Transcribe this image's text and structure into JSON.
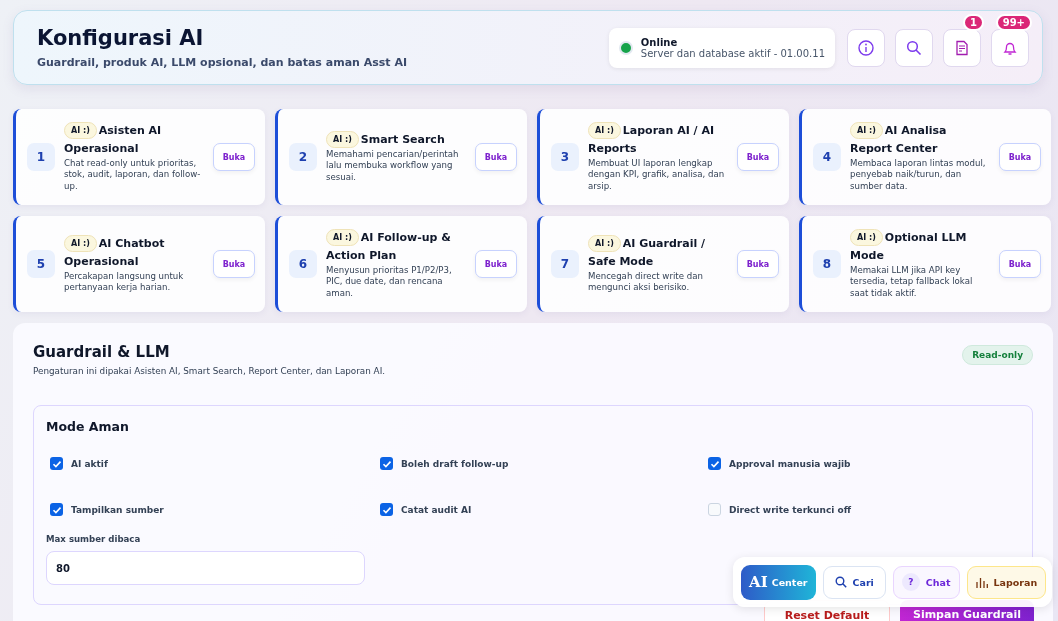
{
  "header": {
    "title": "Konfigurasi AI",
    "subtitle": "Guardrail, produk AI, LLM opsional, dan batas aman Asst AI",
    "status": {
      "online": true,
      "label": "Online",
      "detail": "Server dan database aktif - 01.00.11"
    },
    "actions": [
      {
        "kind": "info"
      },
      {
        "kind": "search"
      },
      {
        "kind": "document",
        "badge": "1"
      },
      {
        "kind": "bell",
        "badge": "99+"
      }
    ]
  },
  "features": [
    {
      "number": "1",
      "tag": "AI :)",
      "title": "Asisten AI Operasional",
      "description": "Chat read-only untuk prioritas, stok, audit, laporan, dan follow-up.",
      "button": "Buka"
    },
    {
      "number": "2",
      "tag": "AI :)",
      "title": "Smart Search",
      "description": "Memahami pencarian/perintah lalu membuka workflow yang sesuai.",
      "button": "Buka"
    },
    {
      "number": "3",
      "tag": "AI :)",
      "title": "Laporan AI / AI Reports",
      "description": "Membuat UI laporan lengkap dengan KPI, grafik, analisa, dan arsip.",
      "button": "Buka"
    },
    {
      "number": "4",
      "tag": "AI :)",
      "title": "AI Analisa Report Center",
      "description": "Membaca laporan lintas modul, penyebab naik/turun, dan sumber data.",
      "button": "Buka"
    },
    {
      "number": "5",
      "tag": "AI :)",
      "title": "AI Chatbot Operasional",
      "description": "Percakapan langsung untuk pertanyaan kerja harian.",
      "button": "Buka"
    },
    {
      "number": "6",
      "tag": "AI :)",
      "title": "AI Follow-up & Action Plan",
      "description": "Menyusun prioritas P1/P2/P3, PIC, due date, dan rencana aman.",
      "button": "Buka"
    },
    {
      "number": "7",
      "tag": "AI :)",
      "title": "AI Guardrail / Safe Mode",
      "description": "Mencegah direct write dan mengunci aksi berisiko.",
      "button": "Buka"
    },
    {
      "number": "8",
      "tag": "AI :)",
      "title": "Optional LLM Mode",
      "description": "Memakai LLM jika API key tersedia, tetap fallback lokal saat tidak aktif.",
      "button": "Buka"
    }
  ],
  "settings": {
    "title": "Guardrail & LLM",
    "subtitle": "Pengaturan ini dipakai Asisten AI, Smart Search, Report Center, dan Laporan AI.",
    "badge": "Read-only",
    "group": {
      "title": "Mode Aman",
      "options": [
        {
          "label": "AI aktif",
          "checked": true
        },
        {
          "label": "Boleh draft follow-up",
          "checked": true
        },
        {
          "label": "Approval manusia wajib",
          "checked": true
        },
        {
          "label": "Tampilkan sumber",
          "checked": true
        },
        {
          "label": "Catat audit AI",
          "checked": true
        },
        {
          "label": "Direct write terkunci off",
          "checked": false
        }
      ],
      "field": {
        "label": "Max sumber dibaca",
        "value": "80"
      }
    },
    "buttons": [
      {
        "kind": "reset",
        "label": "Reset Default"
      },
      {
        "kind": "save",
        "label": "Simpan Guardrail"
      }
    ]
  },
  "dock": [
    {
      "kind": "center",
      "mark": "AI",
      "label": "Center"
    },
    {
      "kind": "search",
      "label": "Cari"
    },
    {
      "kind": "chat",
      "mark": "?",
      "label": "Chat"
    },
    {
      "kind": "report",
      "label": "Laporan"
    }
  ]
}
